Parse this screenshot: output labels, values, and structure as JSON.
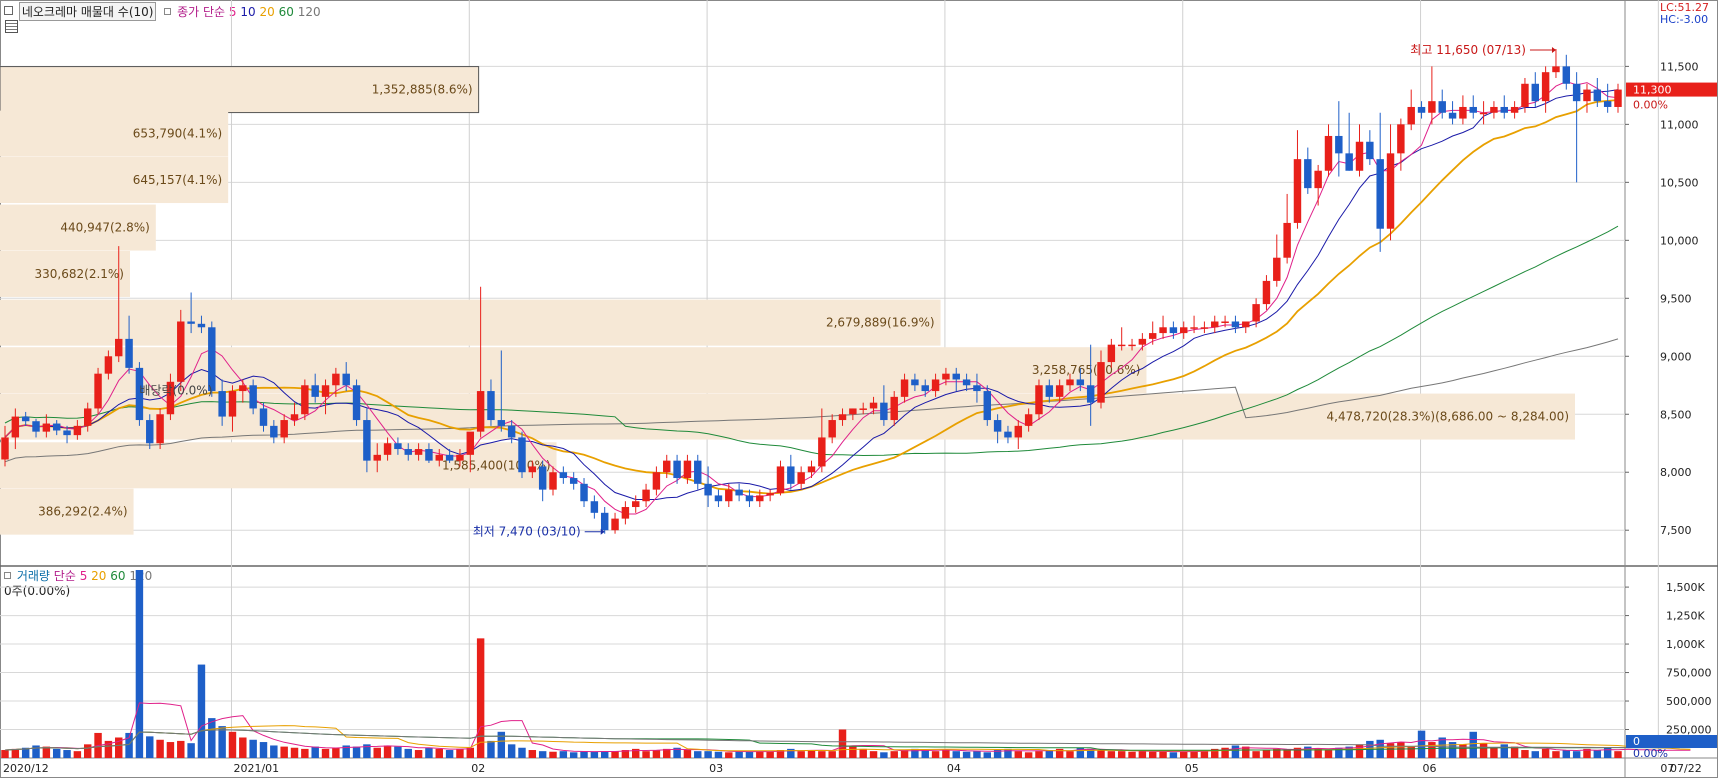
{
  "header": {
    "title": "네오크레마 매물대 수(10)",
    "price_indicator_label": "종가 단순",
    "ma_periods": [
      "5",
      "10",
      "20",
      "60",
      "120"
    ],
    "ma_colors": [
      "#e0218a",
      "#1a1aa8",
      "#e8a000",
      "#1f8a3a",
      "#777777"
    ],
    "lc_label": "LC:51.27",
    "hc_label": "HC:-3.00"
  },
  "chart_data": [
    {
      "type": "candlestick",
      "name": "price",
      "ylim": [
        7200,
        11900
      ],
      "y_ticks": [
        7500,
        8000,
        8500,
        9000,
        9500,
        10000,
        10500,
        11000,
        11500
      ],
      "y_tick_labels": [
        "7,500",
        "8,000",
        "8,500",
        "9,000",
        "9,500",
        "10,000",
        "10,500",
        "11,000",
        "11,500"
      ],
      "x_labels": [
        "2020/12",
        "2021/01",
        "02",
        "03",
        "04",
        "05",
        "06",
        "07",
        "07/22"
      ],
      "current_price": "11,300",
      "current_change": "0.00%",
      "up_color": "#e8201a",
      "down_color": "#1e5fc8",
      "candles": [
        [
          8110,
          8400,
          8050,
          8300
        ],
        [
          8300,
          8550,
          8200,
          8480
        ],
        [
          8480,
          8520,
          8400,
          8440
        ],
        [
          8440,
          8460,
          8300,
          8350
        ],
        [
          8350,
          8500,
          8300,
          8420
        ],
        [
          8420,
          8450,
          8320,
          8360
        ],
        [
          8360,
          8400,
          8250,
          8320
        ],
        [
          8320,
          8450,
          8280,
          8400
        ],
        [
          8400,
          8600,
          8350,
          8550
        ],
        [
          8550,
          8900,
          8500,
          8850
        ],
        [
          8850,
          9050,
          8800,
          9000
        ],
        [
          9000,
          9950,
          8950,
          9150
        ],
        [
          9150,
          9350,
          8850,
          8900
        ],
        [
          8900,
          8950,
          8400,
          8450
        ],
        [
          8450,
          8500,
          8200,
          8250
        ],
        [
          8250,
          8550,
          8200,
          8500
        ],
        [
          8500,
          8850,
          8450,
          8780
        ],
        [
          8780,
          9400,
          8700,
          9300
        ],
        [
          9300,
          9550,
          9200,
          9280
        ],
        [
          9280,
          9350,
          9200,
          9250
        ],
        [
          9250,
          9300,
          8650,
          8700
        ],
        [
          8700,
          8800,
          8400,
          8480
        ],
        [
          8480,
          8750,
          8350,
          8700
        ],
        [
          8700,
          8800,
          8600,
          8750
        ],
        [
          8750,
          8800,
          8500,
          8550
        ],
        [
          8550,
          8600,
          8350,
          8400
        ],
        [
          8400,
          8450,
          8250,
          8300
        ],
        [
          8300,
          8500,
          8250,
          8450
        ],
        [
          8450,
          8600,
          8400,
          8500
        ],
        [
          8500,
          8800,
          8450,
          8750
        ],
        [
          8750,
          8850,
          8600,
          8650
        ],
        [
          8650,
          8800,
          8500,
          8750
        ],
        [
          8750,
          8900,
          8650,
          8850
        ],
        [
          8850,
          8950,
          8700,
          8750
        ],
        [
          8750,
          8800,
          8400,
          8450
        ],
        [
          8450,
          8550,
          8000,
          8100
        ],
        [
          8100,
          8250,
          8000,
          8150
        ],
        [
          8150,
          8300,
          8100,
          8250
        ],
        [
          8250,
          8300,
          8150,
          8200
        ],
        [
          8200,
          8250,
          8100,
          8150
        ],
        [
          8150,
          8250,
          8100,
          8200
        ],
        [
          8200,
          8250,
          8080,
          8100
        ],
        [
          8100,
          8200,
          8050,
          8150
        ],
        [
          8150,
          8200,
          8080,
          8100
        ],
        [
          8100,
          8200,
          8050,
          8150
        ],
        [
          8150,
          8250,
          8000,
          8350
        ],
        [
          8350,
          9600,
          8300,
          8700
        ],
        [
          8700,
          8800,
          8400,
          8450
        ],
        [
          8450,
          9050,
          8350,
          8400
        ],
        [
          8400,
          8450,
          8250,
          8300
        ],
        [
          8300,
          8350,
          7950,
          8000
        ],
        [
          8000,
          8100,
          7950,
          8050
        ],
        [
          8050,
          8100,
          7750,
          7850
        ],
        [
          7850,
          8050,
          7800,
          8000
        ],
        [
          8000,
          8050,
          7900,
          7950
        ],
        [
          7950,
          8000,
          7850,
          7900
        ],
        [
          7900,
          7950,
          7700,
          7750
        ],
        [
          7750,
          7800,
          7600,
          7650
        ],
        [
          7650,
          7700,
          7470,
          7500
        ],
        [
          7500,
          7650,
          7470,
          7600
        ],
        [
          7600,
          7750,
          7550,
          7700
        ],
        [
          7700,
          7800,
          7650,
          7750
        ],
        [
          7750,
          7900,
          7700,
          7850
        ],
        [
          7850,
          8050,
          7800,
          8000
        ],
        [
          8000,
          8150,
          7950,
          8100
        ],
        [
          8100,
          8150,
          7900,
          7950
        ],
        [
          7950,
          8150,
          7900,
          8100
        ],
        [
          8100,
          8150,
          7850,
          7900
        ],
        [
          7900,
          8050,
          7700,
          7800
        ],
        [
          7800,
          7850,
          7700,
          7750
        ],
        [
          7750,
          7900,
          7700,
          7850
        ],
        [
          7850,
          7900,
          7750,
          7800
        ],
        [
          7800,
          7850,
          7700,
          7750
        ],
        [
          7750,
          7850,
          7700,
          7800
        ],
        [
          7800,
          7850,
          7750,
          7820
        ],
        [
          7820,
          8100,
          7800,
          8050
        ],
        [
          8050,
          8150,
          7850,
          7900
        ],
        [
          7900,
          8050,
          7850,
          8000
        ],
        [
          8000,
          8100,
          7950,
          8050
        ],
        [
          8050,
          8550,
          8000,
          8300
        ],
        [
          8300,
          8500,
          8250,
          8450
        ],
        [
          8450,
          8550,
          8400,
          8500
        ],
        [
          8500,
          8550,
          8450,
          8550
        ],
        [
          8550,
          8600,
          8500,
          8550
        ],
        [
          8550,
          8650,
          8500,
          8600
        ],
        [
          8600,
          8750,
          8400,
          8450
        ],
        [
          8450,
          8700,
          8400,
          8650
        ],
        [
          8650,
          8850,
          8600,
          8800
        ],
        [
          8800,
          8850,
          8700,
          8750
        ],
        [
          8750,
          8800,
          8650,
          8700
        ],
        [
          8700,
          8850,
          8650,
          8800
        ],
        [
          8800,
          8900,
          8750,
          8850
        ],
        [
          8850,
          8900,
          8700,
          8800
        ],
        [
          8800,
          8850,
          8700,
          8750
        ],
        [
          8750,
          8850,
          8600,
          8700
        ],
        [
          8700,
          8750,
          8400,
          8450
        ],
        [
          8450,
          8500,
          8250,
          8350
        ],
        [
          8350,
          8400,
          8250,
          8300
        ],
        [
          8300,
          8450,
          8200,
          8400
        ],
        [
          8400,
          8550,
          8350,
          8500
        ],
        [
          8500,
          8800,
          8450,
          8750
        ],
        [
          8750,
          8800,
          8600,
          8650
        ],
        [
          8650,
          8800,
          8600,
          8750
        ],
        [
          8750,
          8850,
          8700,
          8800
        ],
        [
          8800,
          8900,
          8700,
          8750
        ],
        [
          8750,
          9100,
          8400,
          8600
        ],
        [
          8600,
          9050,
          8550,
          8950
        ],
        [
          8950,
          9150,
          8900,
          9100
        ],
        [
          9100,
          9250,
          9050,
          9100
        ],
        [
          9100,
          9150,
          9050,
          9100
        ],
        [
          9100,
          9200,
          9050,
          9150
        ],
        [
          9150,
          9300,
          9100,
          9200
        ],
        [
          9200,
          9350,
          9150,
          9250
        ],
        [
          9250,
          9300,
          9150,
          9200
        ],
        [
          9200,
          9300,
          9150,
          9250
        ],
        [
          9250,
          9350,
          9200,
          9250
        ],
        [
          9250,
          9300,
          9200,
          9250
        ],
        [
          9250,
          9350,
          9200,
          9300
        ],
        [
          9300,
          9350,
          9250,
          9300
        ],
        [
          9300,
          9350,
          9200,
          9250
        ],
        [
          9250,
          9300,
          9200,
          9300
        ],
        [
          9300,
          9500,
          9250,
          9450
        ],
        [
          9450,
          9700,
          9400,
          9650
        ],
        [
          9650,
          10050,
          9600,
          9850
        ],
        [
          9850,
          10400,
          9800,
          10150
        ],
        [
          10150,
          10950,
          10100,
          10700
        ],
        [
          10700,
          10800,
          10400,
          10450
        ],
        [
          10450,
          10650,
          10300,
          10600
        ],
        [
          10600,
          11000,
          10550,
          10900
        ],
        [
          10900,
          11200,
          10550,
          10750
        ],
        [
          10750,
          11100,
          10600,
          10600
        ],
        [
          10600,
          11000,
          10550,
          10850
        ],
        [
          10850,
          10950,
          10650,
          10700
        ],
        [
          10700,
          11100,
          9900,
          10100
        ],
        [
          10100,
          11000,
          10000,
          10750
        ],
        [
          10750,
          11050,
          10600,
          11000
        ],
        [
          11000,
          11300,
          10950,
          11150
        ],
        [
          11150,
          11200,
          11050,
          11100
        ],
        [
          11100,
          11500,
          11000,
          11200
        ],
        [
          11200,
          11300,
          11050,
          11100
        ],
        [
          11100,
          11200,
          11000,
          11050
        ],
        [
          11050,
          11250,
          11000,
          11150
        ],
        [
          11150,
          11250,
          11050,
          11100
        ],
        [
          11100,
          11200,
          11000,
          11100
        ],
        [
          11100,
          11200,
          11050,
          11150
        ],
        [
          11150,
          11250,
          11050,
          11100
        ],
        [
          11100,
          11200,
          11050,
          11150
        ],
        [
          11150,
          11400,
          11100,
          11350
        ],
        [
          11350,
          11450,
          11150,
          11200
        ],
        [
          11200,
          11500,
          11100,
          11450
        ],
        [
          11450,
          11650,
          11400,
          11500
        ],
        [
          11500,
          11600,
          11300,
          11350
        ],
        [
          11350,
          11450,
          10500,
          11200
        ],
        [
          11200,
          11350,
          11100,
          11300
        ],
        [
          11300,
          11400,
          11150,
          11200
        ],
        [
          11200,
          11350,
          11100,
          11150
        ],
        [
          11150,
          11350,
          11100,
          11300
        ]
      ],
      "annotations": {
        "high_label": "최고 11,650 (07/13)",
        "low_label": "최저 7,470 (03/10)",
        "overlap_label": "배당락(0.0%)"
      },
      "volume_profile": [
        {
          "label": "1,352,885(8.6%)",
          "price": 11300
        },
        {
          "label": "653,790(4.1%)",
          "price": 10920
        },
        {
          "label": "645,157(4.1%)",
          "price": 10520
        },
        {
          "label": "440,947(2.8%)",
          "price": 10110
        },
        {
          "label": "330,682(2.1%)",
          "price": 9710
        },
        {
          "label": "2,679,889(16.9%)",
          "price": 9290
        },
        {
          "label": "3,258,765(20.6%)",
          "price": 8880
        },
        {
          "label": "4,478,720(28.3%)(8,686.00 ~ 8,284.00)",
          "price": 8480
        },
        {
          "label": "1,585,400(10.0%)",
          "price": 8060
        },
        {
          "label": "386,292(2.4%)",
          "price": 7660
        }
      ]
    },
    {
      "type": "bar",
      "name": "volume",
      "ylim": [
        0,
        1650000
      ],
      "y_ticks": [
        250000,
        500000,
        750000,
        1000000,
        1250000,
        1500000
      ],
      "y_tick_labels": [
        "250,000",
        "500,000",
        "750,000",
        "1,000K",
        "1,250K",
        "1,500K"
      ],
      "current_value": "0",
      "current_change": "0.00%",
      "values": [
        70000,
        80000,
        90000,
        110000,
        100000,
        80000,
        70000,
        60000,
        120000,
        220000,
        150000,
        180000,
        220000,
        1650000,
        190000,
        160000,
        140000,
        150000,
        130000,
        820000,
        350000,
        280000,
        230000,
        180000,
        160000,
        140000,
        110000,
        100000,
        90000,
        80000,
        100000,
        80000,
        90000,
        110000,
        100000,
        120000,
        90000,
        110000,
        100000,
        80000,
        70000,
        90000,
        80000,
        70000,
        80000,
        90000,
        1050000,
        150000,
        230000,
        120000,
        90000,
        70000,
        60000,
        55000,
        60000,
        50000,
        60000,
        55000,
        60000,
        60000,
        70000,
        80000,
        60000,
        70000,
        80000,
        90000,
        70000,
        60000,
        60000,
        55000,
        50000,
        60000,
        55000,
        60000,
        55000,
        70000,
        80000,
        60000,
        70000,
        60000,
        60000,
        250000,
        100000,
        80000,
        60000,
        50000,
        60000,
        70000,
        80000,
        70000,
        60000,
        70000,
        60000,
        55000,
        60000,
        50000,
        70000,
        80000,
        60000,
        50000,
        60000,
        70000,
        80000,
        60000,
        90000,
        80000,
        70000,
        60000,
        60000,
        55000,
        60000,
        55000,
        60000,
        50000,
        55000,
        60000,
        70000,
        80000,
        90000,
        110000,
        100000,
        60000,
        70000,
        80000,
        70000,
        90000,
        100000,
        80000,
        70000,
        90000,
        100000,
        120000,
        150000,
        160000,
        130000,
        140000,
        100000,
        240000,
        140000,
        180000,
        140000,
        120000,
        230000,
        130000,
        90000,
        120000,
        100000,
        70000,
        60000,
        80000,
        60000,
        70000,
        60000,
        80000,
        70000,
        90000,
        60000,
        80000,
        60000,
        70000,
        60000,
        70000,
        80000,
        60000
      ]
    }
  ],
  "volume_header": {
    "title": "거래량",
    "indicator_label": "단순",
    "ma_periods": [
      "5",
      "20",
      "60",
      "120"
    ],
    "ma_colors": [
      "#e0218a",
      "#e8a000",
      "#1f8a3a",
      "#777777"
    ],
    "summary": "0주(0.00%)"
  }
}
